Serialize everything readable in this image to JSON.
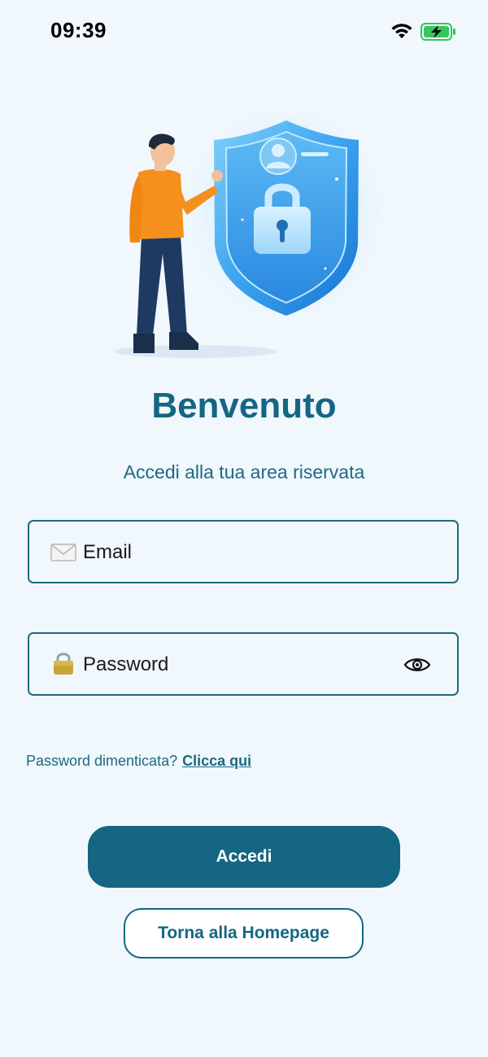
{
  "status_bar": {
    "time": "09:39",
    "icons": [
      "wifi-icon",
      "battery-charging-icon"
    ],
    "battery_color": "#34c759"
  },
  "hero": {
    "illustration": "person-with-security-shield",
    "icons": [
      "shield-icon",
      "padlock-icon",
      "user-profile-icon"
    ]
  },
  "login": {
    "title": "Benvenuto",
    "subtitle": "Accedi alla tua area riservata",
    "email": {
      "icon": "envelope-icon",
      "placeholder": "Email",
      "value": ""
    },
    "password": {
      "icon": "padlock-icon",
      "placeholder": "Password",
      "value": "",
      "toggle_icon": "eye-icon"
    },
    "forgot_text": "Password dimenticata?",
    "forgot_link": "Clicca qui",
    "submit_label": "Accedi",
    "back_label": "Torna alla Homepage"
  },
  "colors": {
    "background": "#f0f7fd",
    "primary": "#146683",
    "text_accent": "#1d6a82",
    "shirt": "#f5901e",
    "shield": "#3aa0ea"
  }
}
